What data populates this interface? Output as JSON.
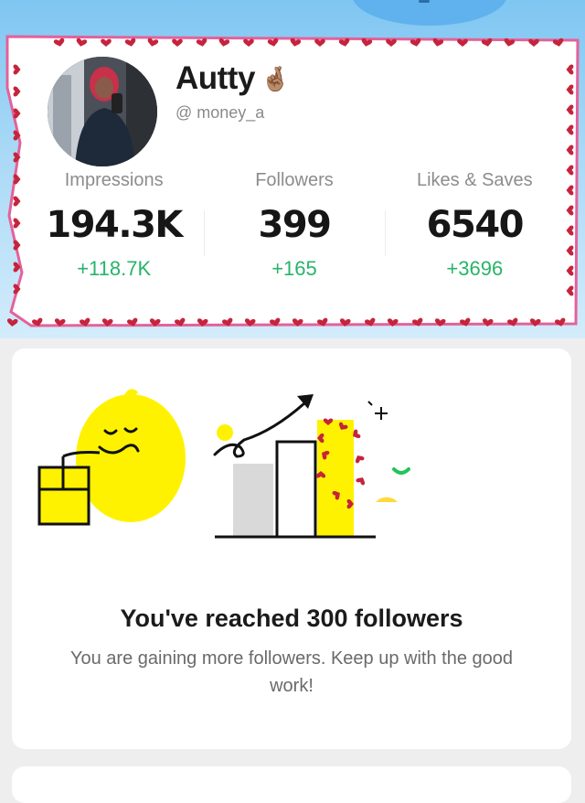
{
  "profile": {
    "name": "Autty",
    "name_emoji": "🤞🏽",
    "handle": "@ money_a"
  },
  "stats": [
    {
      "label": "Impressions",
      "value": "194.3K",
      "delta": "+118.7K"
    },
    {
      "label": "Followers",
      "value": "399",
      "delta": "+165"
    },
    {
      "label": "Likes & Saves",
      "value": "6540",
      "delta": "+3696"
    }
  ],
  "milestone": {
    "title": "You've reached 300 followers",
    "body": "You are gaining more followers. Keep up with the good work!",
    "illustration": "lemonade-growth-chart-illustration"
  },
  "colors": {
    "delta_green": "#27b46a",
    "frame_pink": "#e4619a",
    "heart_red": "#c5243c",
    "lemon_yellow": "#fff200",
    "sky_blue": "#7fc6f2"
  }
}
